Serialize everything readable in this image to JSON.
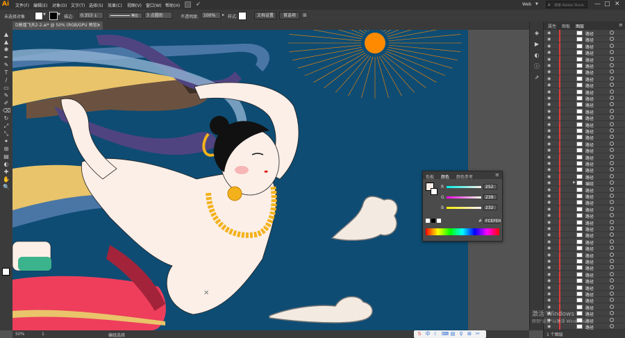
{
  "app": {
    "logo": "Ai"
  },
  "menu": [
    "文件(F)",
    "编辑(E)",
    "对象(O)",
    "文字(T)",
    "选择(S)",
    "效果(C)",
    "视图(V)",
    "窗口(W)",
    "帮助(H)"
  ],
  "workspace": {
    "label": "Web",
    "search_placeholder": "搜索 Adobe Stock"
  },
  "window_controls": [
    "—",
    "□",
    "✕"
  ],
  "control_bar": {
    "selection_label": "未选择对象",
    "stroke_label": "描边:",
    "stroke_weight": "0.353 ↓",
    "stroke_style": "等比",
    "brush": "3 点圆形",
    "opacity_label": "不透明度:",
    "opacity_value": "100%",
    "style_label": "样式:",
    "doc_setup_button": "文档设置",
    "preferences_button": "首选项",
    "fill_color": "#ffffff",
    "stroke_color": "#000000"
  },
  "document_tab": {
    "title": "D敦煌飞天2-2.ai* @ 50% (RGB/GPU 预览)",
    "close": "×"
  },
  "tools": [
    "▲",
    "▲",
    "✱",
    "✒",
    "✎",
    "T",
    "/",
    "▭",
    "✎",
    "✐",
    "⌫",
    "↻",
    "⤢",
    "⤡",
    "✦",
    "⊞",
    "▤",
    "◐",
    "✚",
    "✋",
    "🔍"
  ],
  "status": {
    "zoom": "50%",
    "page": "1",
    "tool_name": "编组选择"
  },
  "right_icons": [
    "◈",
    "▶",
    "◐",
    "ⓘ",
    "⇗"
  ],
  "layers_panel": {
    "tabs": [
      "属性",
      "图板",
      "图层"
    ],
    "active_tab": 2,
    "rows": [
      {
        "name": "路径",
        "expander": false
      },
      {
        "name": "路径",
        "expander": false
      },
      {
        "name": "路径",
        "expander": false
      },
      {
        "name": "路径",
        "expander": false
      },
      {
        "name": "路径",
        "expander": false
      },
      {
        "name": "路径",
        "expander": false
      },
      {
        "name": "路径",
        "expander": false
      },
      {
        "name": "路径",
        "expander": false
      },
      {
        "name": "路径",
        "expander": false
      },
      {
        "name": "路径",
        "expander": false
      },
      {
        "name": "路径",
        "expander": false
      },
      {
        "name": "路径",
        "expander": false
      },
      {
        "name": "路径",
        "expander": false
      },
      {
        "name": "路径",
        "expander": false
      },
      {
        "name": "路径",
        "expander": false
      },
      {
        "name": "路径",
        "expander": false
      },
      {
        "name": "路径",
        "expander": false
      },
      {
        "name": "路径",
        "expander": false
      },
      {
        "name": "路径",
        "expander": false
      },
      {
        "name": "路径",
        "expander": false
      },
      {
        "name": "路径",
        "expander": false
      },
      {
        "name": "路径",
        "expander": false
      },
      {
        "name": "路径",
        "expander": false
      },
      {
        "name": "编组",
        "expander": true
      },
      {
        "name": "路径",
        "expander": false
      },
      {
        "name": "路径",
        "expander": false
      },
      {
        "name": "路径",
        "expander": false
      },
      {
        "name": "路径",
        "expander": false
      },
      {
        "name": "路径",
        "expander": false
      },
      {
        "name": "路径",
        "expander": false
      },
      {
        "name": "路径",
        "expander": false
      },
      {
        "name": "路径",
        "expander": false
      },
      {
        "name": "路径",
        "expander": false
      },
      {
        "name": "路径",
        "expander": false
      },
      {
        "name": "路径",
        "expander": false
      },
      {
        "name": "路径",
        "expander": false
      },
      {
        "name": "路径",
        "expander": false
      },
      {
        "name": "路径",
        "expander": false
      },
      {
        "name": "路径",
        "expander": false
      },
      {
        "name": "路径",
        "expander": false
      },
      {
        "name": "路径",
        "expander": false
      },
      {
        "name": "路径",
        "expander": false
      },
      {
        "name": "路径",
        "expander": false
      },
      {
        "name": "路径",
        "expander": false
      },
      {
        "name": "路径",
        "expander": false
      },
      {
        "name": "路径",
        "expander": false
      }
    ],
    "footer": "1 个图层"
  },
  "color_panel": {
    "tabs": [
      "色板",
      "颜色",
      "颜色参考"
    ],
    "active_tab": 1,
    "channels": [
      {
        "label": "R",
        "value": "252",
        "color": "#ff4444"
      },
      {
        "label": "G",
        "value": "239",
        "color": "#3ac13a"
      },
      {
        "label": "B",
        "value": "232",
        "color": "#3d6bff"
      }
    ],
    "hex": "FCEFE8",
    "hex_prefix": "#"
  },
  "watermark": {
    "line1": "激活 Windows",
    "line2": "转到\"设置\"以激活 Windows。"
  },
  "taskbar_icons": [
    "S",
    "中",
    "☾",
    "⌨",
    "▤",
    "♀",
    "⊞",
    "✂"
  ],
  "palette": {
    "sky": "#0e4c73",
    "skin": "#fcefe8",
    "sun": "#ff8a00",
    "ribbon_blue": "#4a76a6",
    "ribbon_yellow": "#e9c46a",
    "ribbon_purple": "#4f4480",
    "skirt": "#ee3e5c",
    "gold": "#f3b21c",
    "cloud": "#f3ebe1"
  }
}
